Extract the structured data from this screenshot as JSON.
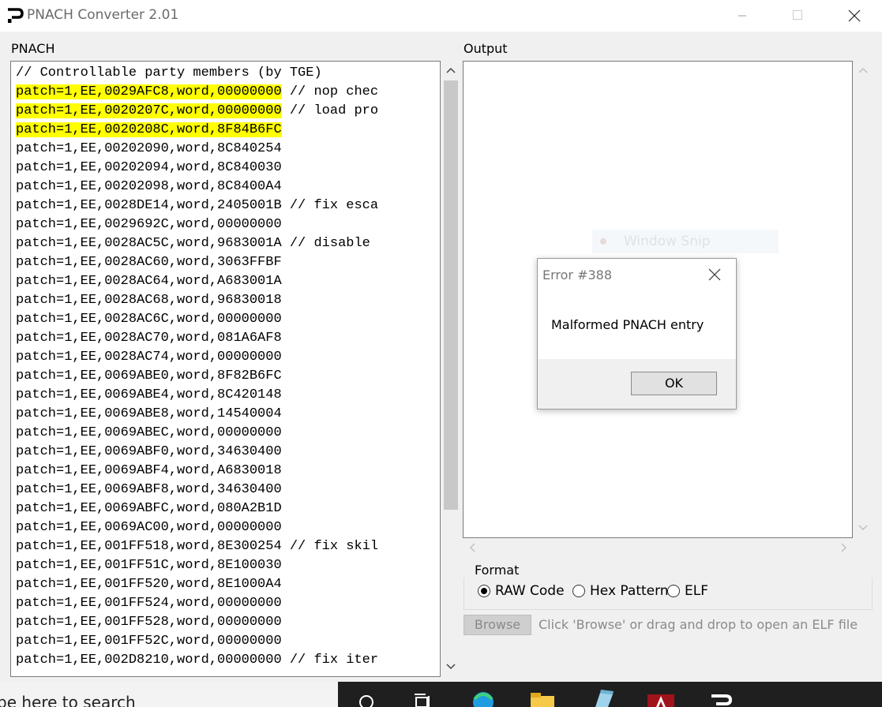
{
  "window": {
    "title": "PNACH Converter 2.01",
    "controls": [
      "minimize",
      "maximize",
      "close"
    ]
  },
  "pnach": {
    "label": "PNACH",
    "lines": [
      {
        "text": "// Controllable party members (by TGE)",
        "highlight": ""
      },
      {
        "text": " // nop chec",
        "highlight": "patch=1,EE,0029AFC8,word,00000000"
      },
      {
        "text": " // load pro",
        "highlight": "patch=1,EE,0020207C,word,00000000"
      },
      {
        "text": "",
        "highlight": "patch=1,EE,0020208C,word,8F84B6FC"
      },
      {
        "text": "patch=1,EE,00202090,word,8C840254",
        "highlight": ""
      },
      {
        "text": "patch=1,EE,00202094,word,8C840030",
        "highlight": ""
      },
      {
        "text": "patch=1,EE,00202098,word,8C8400A4",
        "highlight": ""
      },
      {
        "text": "patch=1,EE,0028DE14,word,2405001B // fix esca",
        "highlight": ""
      },
      {
        "text": "patch=1,EE,0029692C,word,00000000",
        "highlight": ""
      },
      {
        "text": "patch=1,EE,0028AC5C,word,9683001A // disable",
        "highlight": ""
      },
      {
        "text": "patch=1,EE,0028AC60,word,3063FFBF",
        "highlight": ""
      },
      {
        "text": "patch=1,EE,0028AC64,word,A683001A",
        "highlight": ""
      },
      {
        "text": "patch=1,EE,0028AC68,word,96830018",
        "highlight": ""
      },
      {
        "text": "patch=1,EE,0028AC6C,word,00000000",
        "highlight": ""
      },
      {
        "text": "patch=1,EE,0028AC70,word,081A6AF8",
        "highlight": ""
      },
      {
        "text": "patch=1,EE,0028AC74,word,00000000",
        "highlight": ""
      },
      {
        "text": "patch=1,EE,0069ABE0,word,8F82B6FC",
        "highlight": ""
      },
      {
        "text": "patch=1,EE,0069ABE4,word,8C420148",
        "highlight": ""
      },
      {
        "text": "patch=1,EE,0069ABE8,word,14540004",
        "highlight": ""
      },
      {
        "text": "patch=1,EE,0069ABEC,word,00000000",
        "highlight": ""
      },
      {
        "text": "patch=1,EE,0069ABF0,word,34630400",
        "highlight": ""
      },
      {
        "text": "patch=1,EE,0069ABF4,word,A6830018",
        "highlight": ""
      },
      {
        "text": "patch=1,EE,0069ABF8,word,34630400",
        "highlight": ""
      },
      {
        "text": "patch=1,EE,0069ABFC,word,080A2B1D",
        "highlight": ""
      },
      {
        "text": "patch=1,EE,0069AC00,word,00000000",
        "highlight": ""
      },
      {
        "text": "patch=1,EE,001FF518,word,8E300254 // fix skil",
        "highlight": ""
      },
      {
        "text": "patch=1,EE,001FF51C,word,8E100030",
        "highlight": ""
      },
      {
        "text": "patch=1,EE,001FF520,word,8E1000A4",
        "highlight": ""
      },
      {
        "text": "patch=1,EE,001FF524,word,00000000",
        "highlight": ""
      },
      {
        "text": "patch=1,EE,001FF528,word,00000000",
        "highlight": ""
      },
      {
        "text": "patch=1,EE,001FF52C,word,00000000",
        "highlight": ""
      },
      {
        "text": "patch=1,EE,002D8210,word,00000000 // fix iter",
        "highlight": ""
      }
    ]
  },
  "output": {
    "label": "Output",
    "content": ""
  },
  "format": {
    "legend": "Format",
    "options": [
      {
        "label": "RAW Code",
        "selected": true
      },
      {
        "label": "Hex Pattern",
        "selected": false
      },
      {
        "label": "ELF",
        "selected": false
      }
    ],
    "browse_label": "Browse",
    "hint": "Click 'Browse' or drag and drop to open an ELF file"
  },
  "background_window": {
    "title": "Window Snip"
  },
  "dialog": {
    "title": "Error #388",
    "message": "Malformed PNACH entry",
    "ok_label": "OK"
  },
  "taskbar": {
    "search_text": "pe here to search",
    "icons": [
      "search-icon",
      "task-view-icon",
      "edge-icon",
      "file-explorer-icon",
      "notepad-icon",
      "acrobat-icon",
      "pnach-app-icon"
    ]
  },
  "colors": {
    "highlight": "#ffff00",
    "window_bg": "#f0f0f0",
    "taskbar": "#1f1f1f"
  }
}
